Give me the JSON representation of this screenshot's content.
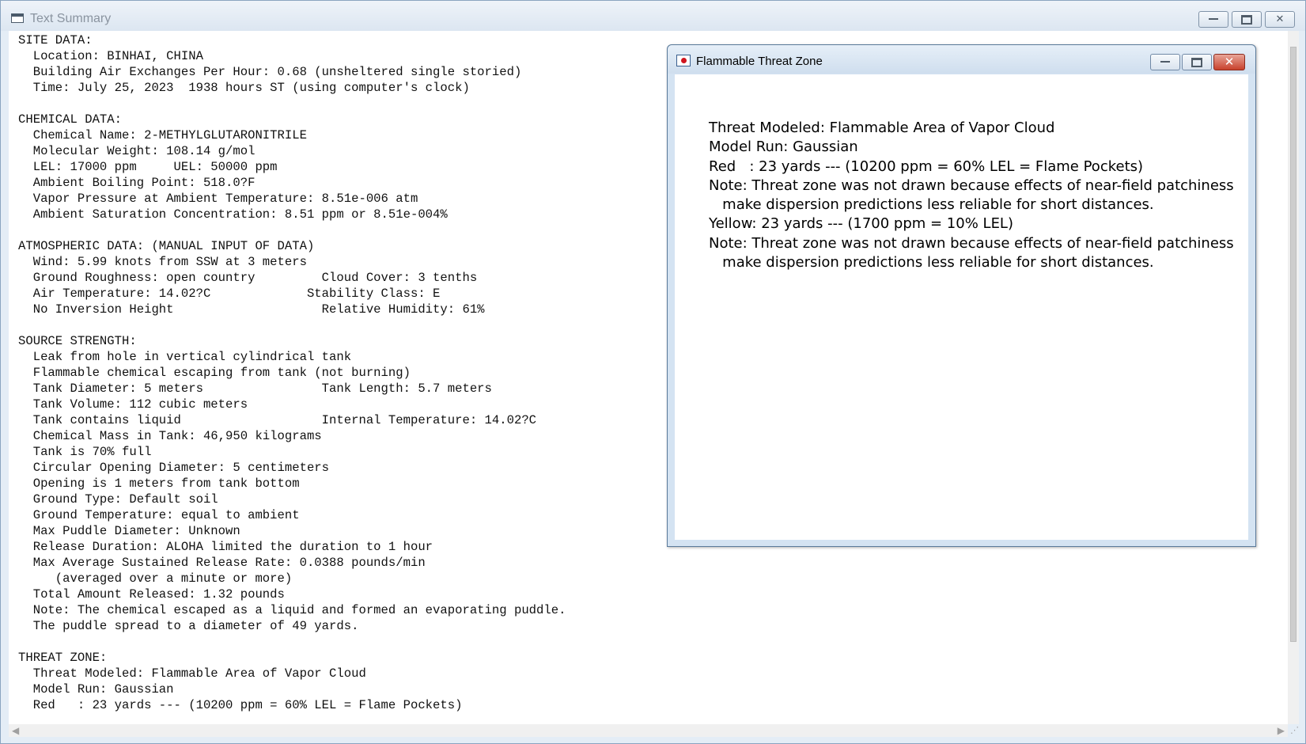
{
  "main_window": {
    "title": "Text Summary",
    "summary_lines": [
      "SITE DATA:",
      "  Location: BINHAI, CHINA",
      "  Building Air Exchanges Per Hour: 0.68 (unsheltered single storied)",
      "  Time: July 25, 2023  1938 hours ST (using computer's clock)",
      "",
      "CHEMICAL DATA:",
      "  Chemical Name: 2-METHYLGLUTARONITRILE",
      "  Molecular Weight: 108.14 g/mol",
      "  LEL: 17000 ppm     UEL: 50000 ppm",
      "  Ambient Boiling Point: 518.0?F",
      "  Vapor Pressure at Ambient Temperature: 8.51e-006 atm",
      "  Ambient Saturation Concentration: 8.51 ppm or 8.51e-004%",
      "",
      "ATMOSPHERIC DATA: (MANUAL INPUT OF DATA)",
      "  Wind: 5.99 knots from SSW at 3 meters",
      "  Ground Roughness: open country         Cloud Cover: 3 tenths",
      "  Air Temperature: 14.02?C             Stability Class: E",
      "  No Inversion Height                    Relative Humidity: 61%",
      "",
      "SOURCE STRENGTH:",
      "  Leak from hole in vertical cylindrical tank",
      "  Flammable chemical escaping from tank (not burning)",
      "  Tank Diameter: 5 meters                Tank Length: 5.7 meters",
      "  Tank Volume: 112 cubic meters",
      "  Tank contains liquid                   Internal Temperature: 14.02?C",
      "  Chemical Mass in Tank: 46,950 kilograms",
      "  Tank is 70% full",
      "  Circular Opening Diameter: 5 centimeters",
      "  Opening is 1 meters from tank bottom",
      "  Ground Type: Default soil",
      "  Ground Temperature: equal to ambient",
      "  Max Puddle Diameter: Unknown",
      "  Release Duration: ALOHA limited the duration to 1 hour",
      "  Max Average Sustained Release Rate: 0.0388 pounds/min",
      "     (averaged over a minute or more)",
      "  Total Amount Released: 1.32 pounds",
      "  Note: The chemical escaped as a liquid and formed an evaporating puddle.",
      "  The puddle spread to a diameter of 49 yards.",
      "",
      "THREAT ZONE:",
      "  Threat Modeled: Flammable Area of Vapor Cloud",
      "  Model Run: Gaussian",
      "  Red   : 23 yards --- (10200 ppm = 60% LEL = Flame Pockets)"
    ]
  },
  "threat_window": {
    "title": "Flammable Threat Zone",
    "lines": [
      "Threat Modeled: Flammable Area of Vapor Cloud",
      "Model Run: Gaussian",
      "Red   : 23 yards --- (10200 ppm = 60% LEL = Flame Pockets)",
      "Note: Threat zone was not drawn because effects of near-field patchiness",
      "   make dispersion predictions less reliable for short distances.",
      "Yellow: 23 yards --- (1700 ppm = 10% LEL)",
      "Note: Threat zone was not drawn because effects of near-field patchiness",
      "   make dispersion predictions less reliable for short distances."
    ]
  },
  "icons": {
    "main_app": "document-icon",
    "threat_app": "flame-map-icon",
    "close_glyph": "✕"
  }
}
